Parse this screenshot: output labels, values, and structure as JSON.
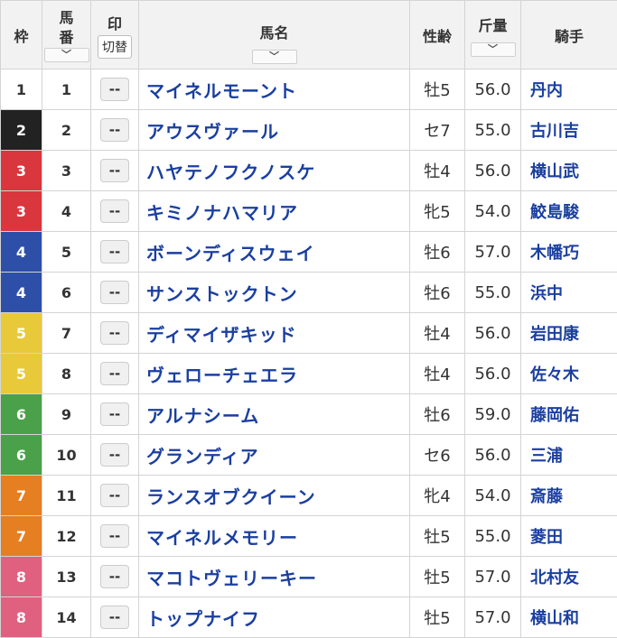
{
  "headers": {
    "waku": "枠",
    "umaban_1": "馬",
    "umaban_2": "番",
    "mark": "印",
    "mark_toggle": "切替",
    "name": "馬名",
    "sex_age": "性齢",
    "weight": "斤量",
    "jockey": "騎手",
    "sort_glyph": "﹀"
  },
  "waku_colors": {
    "1": {
      "bg": "#ffffff",
      "fg": "#333333"
    },
    "2": {
      "bg": "#222222",
      "fg": "#ffffff"
    },
    "3": {
      "bg": "#d9363e",
      "fg": "#ffffff"
    },
    "4": {
      "bg": "#2e4fa8",
      "fg": "#ffffff"
    },
    "5": {
      "bg": "#e8c93a",
      "fg": "#ffffff"
    },
    "6": {
      "bg": "#4aa14a",
      "fg": "#ffffff"
    },
    "7": {
      "bg": "#e67e22",
      "fg": "#ffffff"
    },
    "8": {
      "bg": "#e06080",
      "fg": "#ffffff"
    }
  },
  "rows": [
    {
      "waku": "1",
      "umaban": "1",
      "mark": "--",
      "name": "マイネルモーント",
      "sex_age": "牡5",
      "weight": "56.0",
      "jockey": "丹内"
    },
    {
      "waku": "2",
      "umaban": "2",
      "mark": "--",
      "name": "アウスヴァール",
      "sex_age": "セ7",
      "weight": "55.0",
      "jockey": "古川吉"
    },
    {
      "waku": "3",
      "umaban": "3",
      "mark": "--",
      "name": "ハヤテノフクノスケ",
      "sex_age": "牡4",
      "weight": "56.0",
      "jockey": "横山武"
    },
    {
      "waku": "3",
      "umaban": "4",
      "mark": "--",
      "name": "キミノナハマリア",
      "sex_age": "牝5",
      "weight": "54.0",
      "jockey": "鮫島駿"
    },
    {
      "waku": "4",
      "umaban": "5",
      "mark": "--",
      "name": "ボーンディスウェイ",
      "sex_age": "牡6",
      "weight": "57.0",
      "jockey": "木幡巧"
    },
    {
      "waku": "4",
      "umaban": "6",
      "mark": "--",
      "name": "サンストックトン",
      "sex_age": "牡6",
      "weight": "55.0",
      "jockey": "浜中"
    },
    {
      "waku": "5",
      "umaban": "7",
      "mark": "--",
      "name": "ディマイザキッド",
      "sex_age": "牡4",
      "weight": "56.0",
      "jockey": "岩田康"
    },
    {
      "waku": "5",
      "umaban": "8",
      "mark": "--",
      "name": "ヴェローチェエラ",
      "sex_age": "牡4",
      "weight": "56.0",
      "jockey": "佐々木"
    },
    {
      "waku": "6",
      "umaban": "9",
      "mark": "--",
      "name": "アルナシーム",
      "sex_age": "牡6",
      "weight": "59.0",
      "jockey": "藤岡佑"
    },
    {
      "waku": "6",
      "umaban": "10",
      "mark": "--",
      "name": "グランディア",
      "sex_age": "セ6",
      "weight": "56.0",
      "jockey": "三浦"
    },
    {
      "waku": "7",
      "umaban": "11",
      "mark": "--",
      "name": "ランスオブクイーン",
      "sex_age": "牝4",
      "weight": "54.0",
      "jockey": "斎藤"
    },
    {
      "waku": "7",
      "umaban": "12",
      "mark": "--",
      "name": "マイネルメモリー",
      "sex_age": "牡5",
      "weight": "55.0",
      "jockey": "菱田"
    },
    {
      "waku": "8",
      "umaban": "13",
      "mark": "--",
      "name": "マコトヴェリーキー",
      "sex_age": "牡5",
      "weight": "57.0",
      "jockey": "北村友"
    },
    {
      "waku": "8",
      "umaban": "14",
      "mark": "--",
      "name": "トップナイフ",
      "sex_age": "牡5",
      "weight": "57.0",
      "jockey": "横山和"
    }
  ]
}
